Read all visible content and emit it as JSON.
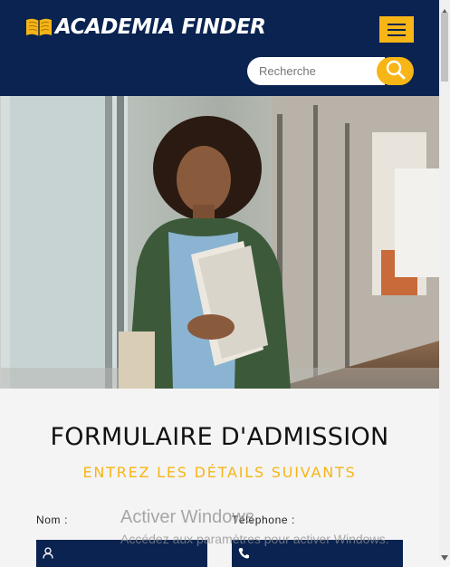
{
  "header": {
    "logo_text": "ACADEMIA FINDER",
    "logo_icon": "open-book-icon",
    "menu_icon": "hamburger-icon",
    "search": {
      "placeholder": "Recherche",
      "value": "",
      "icon": "search-icon"
    }
  },
  "hero": {
    "image": "student-holding-folders-photo"
  },
  "form": {
    "title": "FORMULAIRE D'ADMISSION",
    "subtitle": "ENTREZ LES DÉTAILS SUIVANTS",
    "fields": [
      {
        "label": "Nom :",
        "icon": "user-icon"
      },
      {
        "label": "Téléphone :",
        "icon": "phone-icon"
      }
    ]
  },
  "watermark": {
    "title": "Activer Windows",
    "subtitle": "Accédez aux paramètres pour activer Windows."
  },
  "colors": {
    "navy": "#0a2350",
    "accent": "#f7b516",
    "background": "#f4f4f4"
  }
}
